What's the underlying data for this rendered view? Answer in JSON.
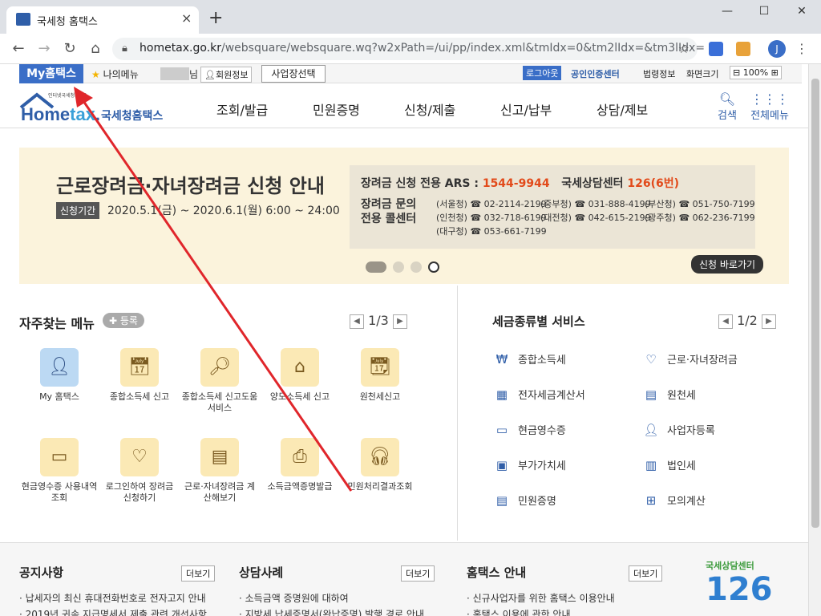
{
  "browser": {
    "tab_title": "국세청 홈택스",
    "tab_close": "×",
    "new_tab": "+",
    "url_host": "hometax.go.kr",
    "url_path": "/websquare/websquare.wq?w2xPath=/ui/pp/index.xml&tmIdx=0&tm2lIdx=&tm3lIdx=",
    "avatar_letter": "J",
    "icons": [
      "back-icon",
      "forward-icon",
      "reload-icon",
      "home-icon",
      "lock-icon",
      "star-icon",
      "menu-icon"
    ]
  },
  "util": {
    "my_hometax": "My홈택스",
    "my_menu": "나의메뉴",
    "name_suffix": "님",
    "member_info": "회원정보",
    "business_select": "사업장선택",
    "logout": "로그아웃",
    "cert_center": "공인인증센터",
    "law_info": "법령정보",
    "screen_size": "화면크기",
    "zoom": "100%"
  },
  "gnb": {
    "logo_small": "인터넷국세청서비스",
    "logo_text": "Hometax.",
    "logo_name": "국세청홈택스",
    "menu": [
      "조회/발급",
      "민원증명",
      "신청/제출",
      "신고/납부",
      "상담/제보"
    ],
    "search": "검색",
    "all_menu": "전체메뉴"
  },
  "banner": {
    "title": "근로장려금·자녀장려금 신청 안내",
    "period_badge": "신청기간",
    "period": "2020.5.1(금) ~ 2020.6.1(월) 6:00 ~ 24:00",
    "ars_label": "장려금 신청 전용 ARS :",
    "ars_number": "1544-9944",
    "center_label": "국세상담센터",
    "center_number": "126(6번)",
    "call_center_label": "장려금 문의 전용 콜센터",
    "phones": [
      "(서울청) ☎ 02-2114-2199",
      "(중부청) ☎ 031-888-4199",
      "(부산청) ☎ 051-750-7199",
      "(인천청) ☎ 032-718-6199",
      "(대전청) ☎ 042-615-2199",
      "(광주청) ☎ 062-236-7199",
      "(대구청) ☎ 053-661-7199"
    ],
    "apply_button": "신청 바로가기"
  },
  "favorites": {
    "title": "자주찾는 메뉴",
    "register": "등록",
    "page": "1/3",
    "items": [
      "My 홈택스",
      "종합소득세 신고",
      "종합소득세 신고도움 서비스",
      "양도소득세 신고",
      "원천세신고",
      "현금영수증 사용내역조회",
      "로그인하여 장려금 신청하기",
      "근로·자녀장려금 계산해보기",
      "소득금액증명발급",
      "민원처리결과조회"
    ]
  },
  "tax_services": {
    "title": "세금종류별 서비스",
    "page": "1/2",
    "items": [
      "종합소득세",
      "근로·자녀장려금",
      "전자세금계산서",
      "원천세",
      "현금영수증",
      "사업자등록",
      "부가가치세",
      "법인세",
      "민원증명",
      "모의계산"
    ]
  },
  "bottom": {
    "notice_title": "공지사항",
    "consult_title": "상담사례",
    "guide_title": "홈택스 안내",
    "more": "더보기",
    "notice_items": [
      "납세자의 최신 휴대전화번호로 전자고지 안내",
      "2019년 귀속 지급명세서 제출 관련 개선사항"
    ],
    "consult_items": [
      "소득금액 증명원에 대하여",
      "지방세 납세증명서(완납증명) 발행 경로 안내"
    ],
    "guide_items": [
      "신규사업자를 위한 홈택스 이용안내",
      "홈택스 이용에 관한 안내"
    ],
    "center_tagline": "국세상담센터",
    "center_number": "126"
  },
  "colors": {
    "brand": "#3a6ec7",
    "accent_red": "#e24a1a",
    "arrow": "#e0262b"
  }
}
